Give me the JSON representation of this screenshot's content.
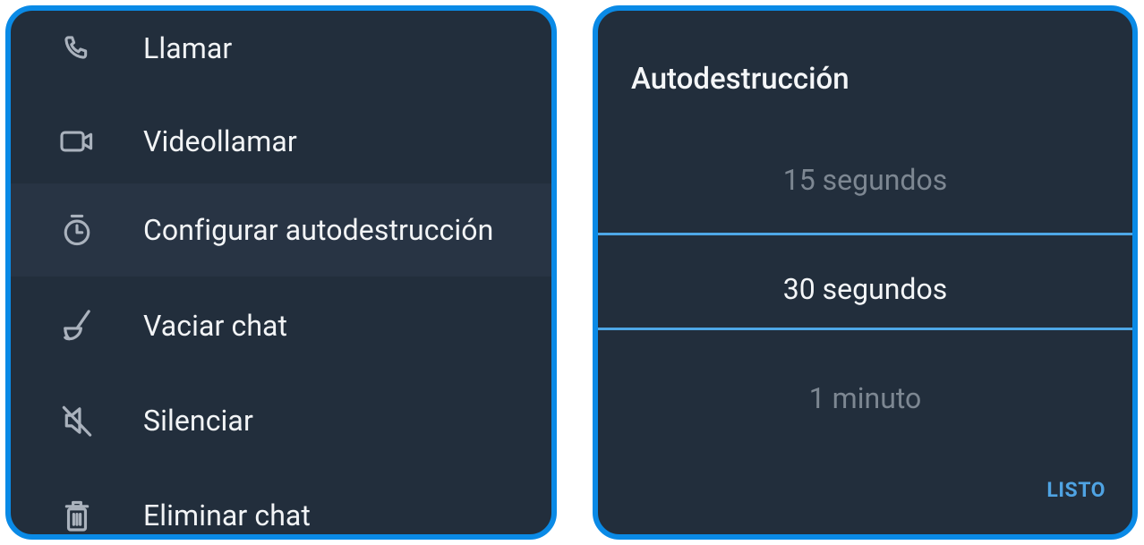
{
  "menu": {
    "items": [
      {
        "label": "Llamar",
        "icon": "phone-icon"
      },
      {
        "label": "Videollamar",
        "icon": "video-camera-icon"
      },
      {
        "label": "Configurar autodestrucción",
        "icon": "timer-icon",
        "highlighted": true
      },
      {
        "label": "Vaciar chat",
        "icon": "broom-icon"
      },
      {
        "label": "Silenciar",
        "icon": "speaker-mute-icon"
      },
      {
        "label": "Eliminar chat",
        "icon": "trash-icon"
      }
    ]
  },
  "dialog": {
    "title": "Autodestrucción",
    "options": {
      "previous": "15 segundos",
      "selected": "30 segundos",
      "next": "1 minuto"
    },
    "done_label": "LISTO"
  },
  "colors": {
    "frame": "#0a8ae6",
    "panel_bg": "#222e3c",
    "highlight_bg": "#283444",
    "accent": "#4ea7e6"
  }
}
